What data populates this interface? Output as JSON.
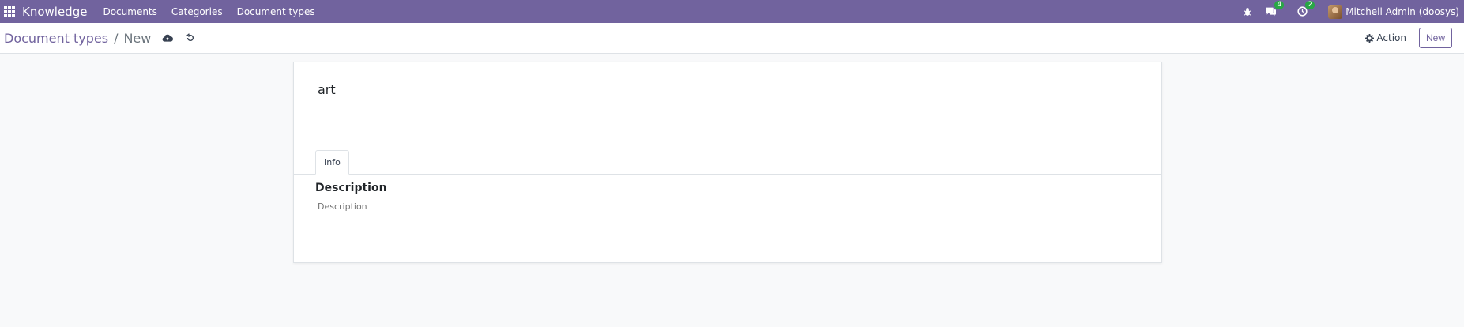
{
  "navbar": {
    "brand": "Knowledge",
    "menu": [
      "Documents",
      "Categories",
      "Document types"
    ],
    "messages_count": "4",
    "activities_count": "2",
    "user_name": "Mitchell Admin (doosys)"
  },
  "control_panel": {
    "breadcrumb_parent": "Document types",
    "breadcrumb_separator": "/",
    "breadcrumb_current": "New",
    "action_label": "Action",
    "new_label": "New"
  },
  "form": {
    "name_value": "art",
    "tab_info": "Info",
    "description_title": "Description",
    "description_placeholder": "Description"
  },
  "colors": {
    "navbar_bg": "#71639e",
    "badge": "#28a745",
    "accent": "#71639e"
  }
}
